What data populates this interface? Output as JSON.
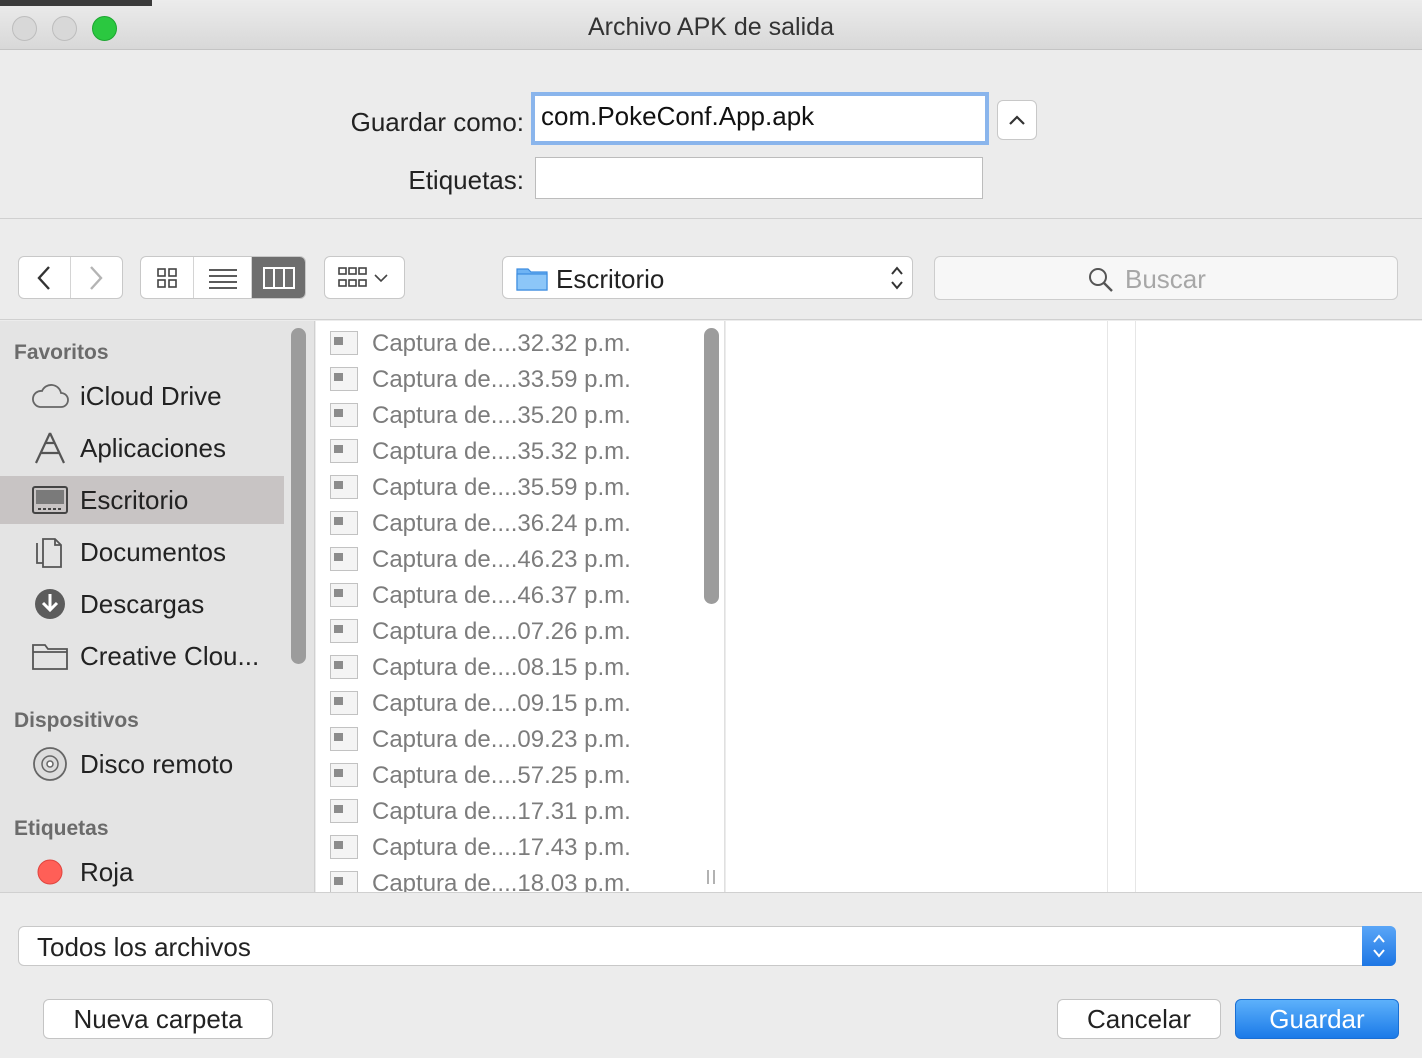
{
  "window": {
    "title": "Archivo APK de salida"
  },
  "save": {
    "save_as_label": "Guardar como:",
    "filename": "com.PokeConf.App.apk",
    "tags_label": "Etiquetas:",
    "tags_value": ""
  },
  "toolbar": {
    "location": "Escritorio",
    "search_placeholder": "Buscar"
  },
  "sidebar": {
    "favorites_header": "Favoritos",
    "favorites": [
      {
        "label": "iCloud Drive",
        "icon": "cloud-icon"
      },
      {
        "label": "Aplicaciones",
        "icon": "applications-icon"
      },
      {
        "label": "Escritorio",
        "icon": "desktop-icon",
        "selected": true
      },
      {
        "label": "Documentos",
        "icon": "documents-icon"
      },
      {
        "label": "Descargas",
        "icon": "downloads-icon"
      },
      {
        "label": "Creative Clou...",
        "icon": "folder-icon"
      }
    ],
    "devices_header": "Dispositivos",
    "devices": [
      {
        "label": "Disco remoto",
        "icon": "disc-icon"
      }
    ],
    "tags_header": "Etiquetas",
    "tags": [
      {
        "label": "Roja",
        "color": "#ff5f57",
        "icon": "red-tag-icon"
      }
    ]
  },
  "files": [
    "Captura de....32.32 p.m.",
    "Captura de....33.59 p.m.",
    "Captura de....35.20 p.m.",
    "Captura de....35.32 p.m.",
    "Captura de....35.59 p.m.",
    "Captura de....36.24 p.m.",
    "Captura de....46.23 p.m.",
    "Captura de....46.37 p.m.",
    "Captura de....07.26 p.m.",
    "Captura de....08.15 p.m.",
    "Captura de....09.15 p.m.",
    "Captura de....09.23 p.m.",
    "Captura de....57.25 p.m.",
    "Captura de....17.31 p.m.",
    "Captura de....17.43 p.m.",
    "Captura de....18.03 p.m."
  ],
  "bottom": {
    "filter": "Todos los archivos",
    "new_folder": "Nueva carpeta",
    "cancel": "Cancelar",
    "save": "Guardar"
  },
  "colors": {
    "accent": "#1b7ae8",
    "selection": "#c8c4c4",
    "zoom": "#2bc840"
  }
}
